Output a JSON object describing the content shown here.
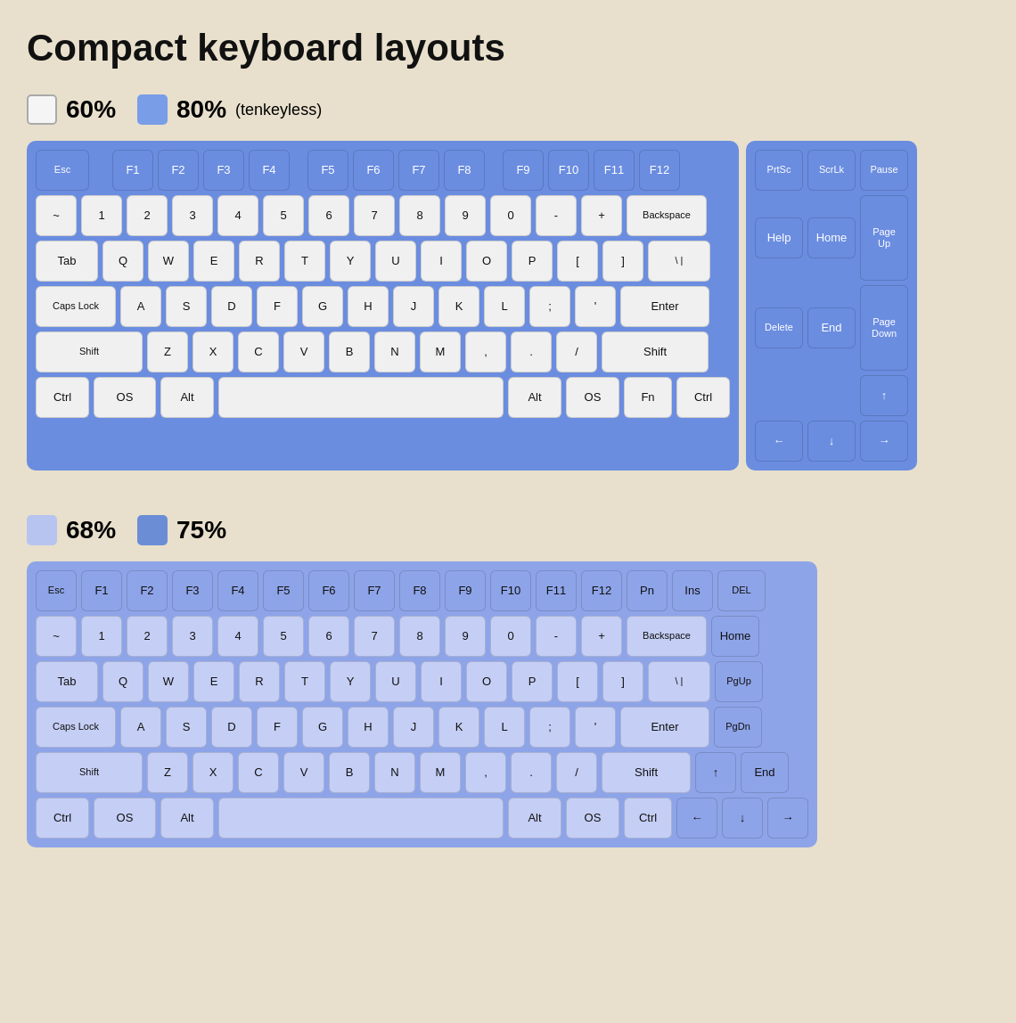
{
  "title": "Compact keyboard layouts",
  "legend1": {
    "item1_pct": "60%",
    "item1_color": "white",
    "item2_pct": "80%",
    "item2_color": "blue",
    "item2_note": "(tenkeyless)"
  },
  "legend2": {
    "item1_pct": "68%",
    "item1_color": "lavender",
    "item2_pct": "75%",
    "item2_color": "blue-med"
  }
}
